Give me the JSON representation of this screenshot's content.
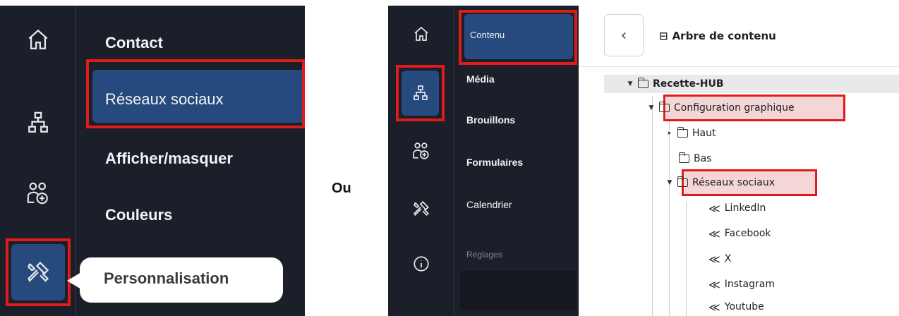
{
  "left_panel": {
    "menu_items": [
      "Contact",
      "Réseaux sociaux",
      "Afficher/masquer",
      "Couleurs"
    ],
    "tooltip": "Personnalisation",
    "rail_icons": [
      "home-icon",
      "sitemap-icon",
      "users-add-icon",
      "tools-icon"
    ]
  },
  "separator": "Ou",
  "right_panel": {
    "menu_items": [
      "Contenu",
      "Média",
      "Brouillons",
      "Formulaires",
      "Calendrier"
    ],
    "section_label": "Réglages",
    "rail_icons": [
      "home-icon",
      "sitemap-icon",
      "users-add-icon",
      "tools-icon",
      "info-icon"
    ],
    "header_title": "Arbre de contenu",
    "tree": {
      "root": "Recette-HUB",
      "config": "Configuration graphique",
      "haut": "Haut",
      "bas": "Bas",
      "reseaux": "Réseaux sociaux",
      "networks": [
        "LinkedIn",
        "Facebook",
        "X",
        "Instagram",
        "Youtube"
      ]
    }
  },
  "colors": {
    "highlight_red": "#e11a1a",
    "active_blue": "#264a7d",
    "dark_bg": "#1b1f2a"
  }
}
